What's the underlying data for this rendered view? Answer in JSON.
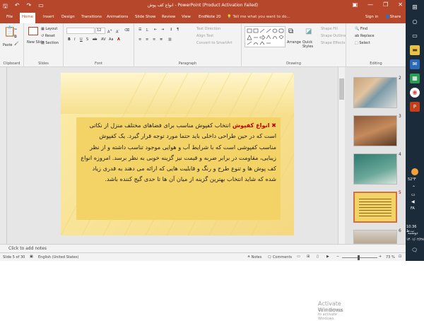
{
  "titlebar": {
    "title": "انواع کف پوش - PowerPoint (Product Activation Failed)",
    "minimize": "—",
    "restore": "❐",
    "close": "✕"
  },
  "tabs": {
    "file": "File",
    "home": "Home",
    "insert": "Insert",
    "design": "Design",
    "transitions": "Transitions",
    "animations": "Animations",
    "slideshow": "Slide Show",
    "review": "Review",
    "view": "View",
    "endnote": "EndNote 20",
    "tellme": "Tell me what you want to do...",
    "signin": "Sign in",
    "share": "Share"
  },
  "ribbon": {
    "clipboard": {
      "paste": "Paste",
      "label": "Clipboard"
    },
    "slides": {
      "new_slide": "New Slide",
      "layout": "Layout",
      "reset": "Reset",
      "section": "Section",
      "label": "Slides"
    },
    "font": {
      "size": "12",
      "label": "Font"
    },
    "paragraph": {
      "text_direction": "Text Direction",
      "align_text": "Align Text",
      "convert": "Convert to SmartArt",
      "label": "Paragraph"
    },
    "drawing": {
      "arrange": "Arrange",
      "quick_styles": "Quick Styles",
      "shape_fill": "Shape Fill",
      "shape_outline": "Shape Outline",
      "shape_effects": "Shape Effects",
      "label": "Drawing"
    },
    "editing": {
      "find": "Find",
      "replace": "Replace",
      "select": "Select",
      "label": "Editing"
    }
  },
  "slide": {
    "line1_pre": "انتخاب کفپوش مناسب برای فضاهای مختلف",
    "line1_hl": "انواع کفپوش",
    "body": "منزل از نکاتی است که در حین طراحی داخلی باید حتما مورد توجه قرار گیرد. یک کفپوش مناسب کفپوشی است که با شرایط آب و هوایی موجود تناسب داشته و از نظر زیبایی، مقاومت در برابر ضربه و قیمت نیز گزینه خوبی به نظر برسد. امروزه انواع کف پوش ها و تنوع طرح و رنگ و قابلیت هایی که ارائه می دهند به قدری زیاد شده که شاید انتخاب بهترین گزینه از میان آن ها تا حدی گیج کننده باشد."
  },
  "thumbnails": [
    {
      "num": "2"
    },
    {
      "num": "3"
    },
    {
      "num": "4"
    },
    {
      "num": "5"
    },
    {
      "num": "6"
    }
  ],
  "notes": {
    "placeholder": "Click to add notes"
  },
  "status": {
    "slide": "Slide 5 of 30",
    "language": "English (United States)",
    "notes": "Notes",
    "comments": "Comments",
    "zoom": "73 %"
  },
  "watermark": {
    "line1": "Activate Windows",
    "line2": "Go to Settings to activate Windows."
  },
  "taskbar": {
    "temp": "52°F",
    "lang": "FA",
    "time": "10:36 ب.ظ",
    "day": "دوشنبه",
    "date": "۱۴۰۱/۰۲/۲۸"
  },
  "colors": {
    "accent": "#b7472a",
    "highlight": "#c00000",
    "textbox": "#f3d365"
  }
}
